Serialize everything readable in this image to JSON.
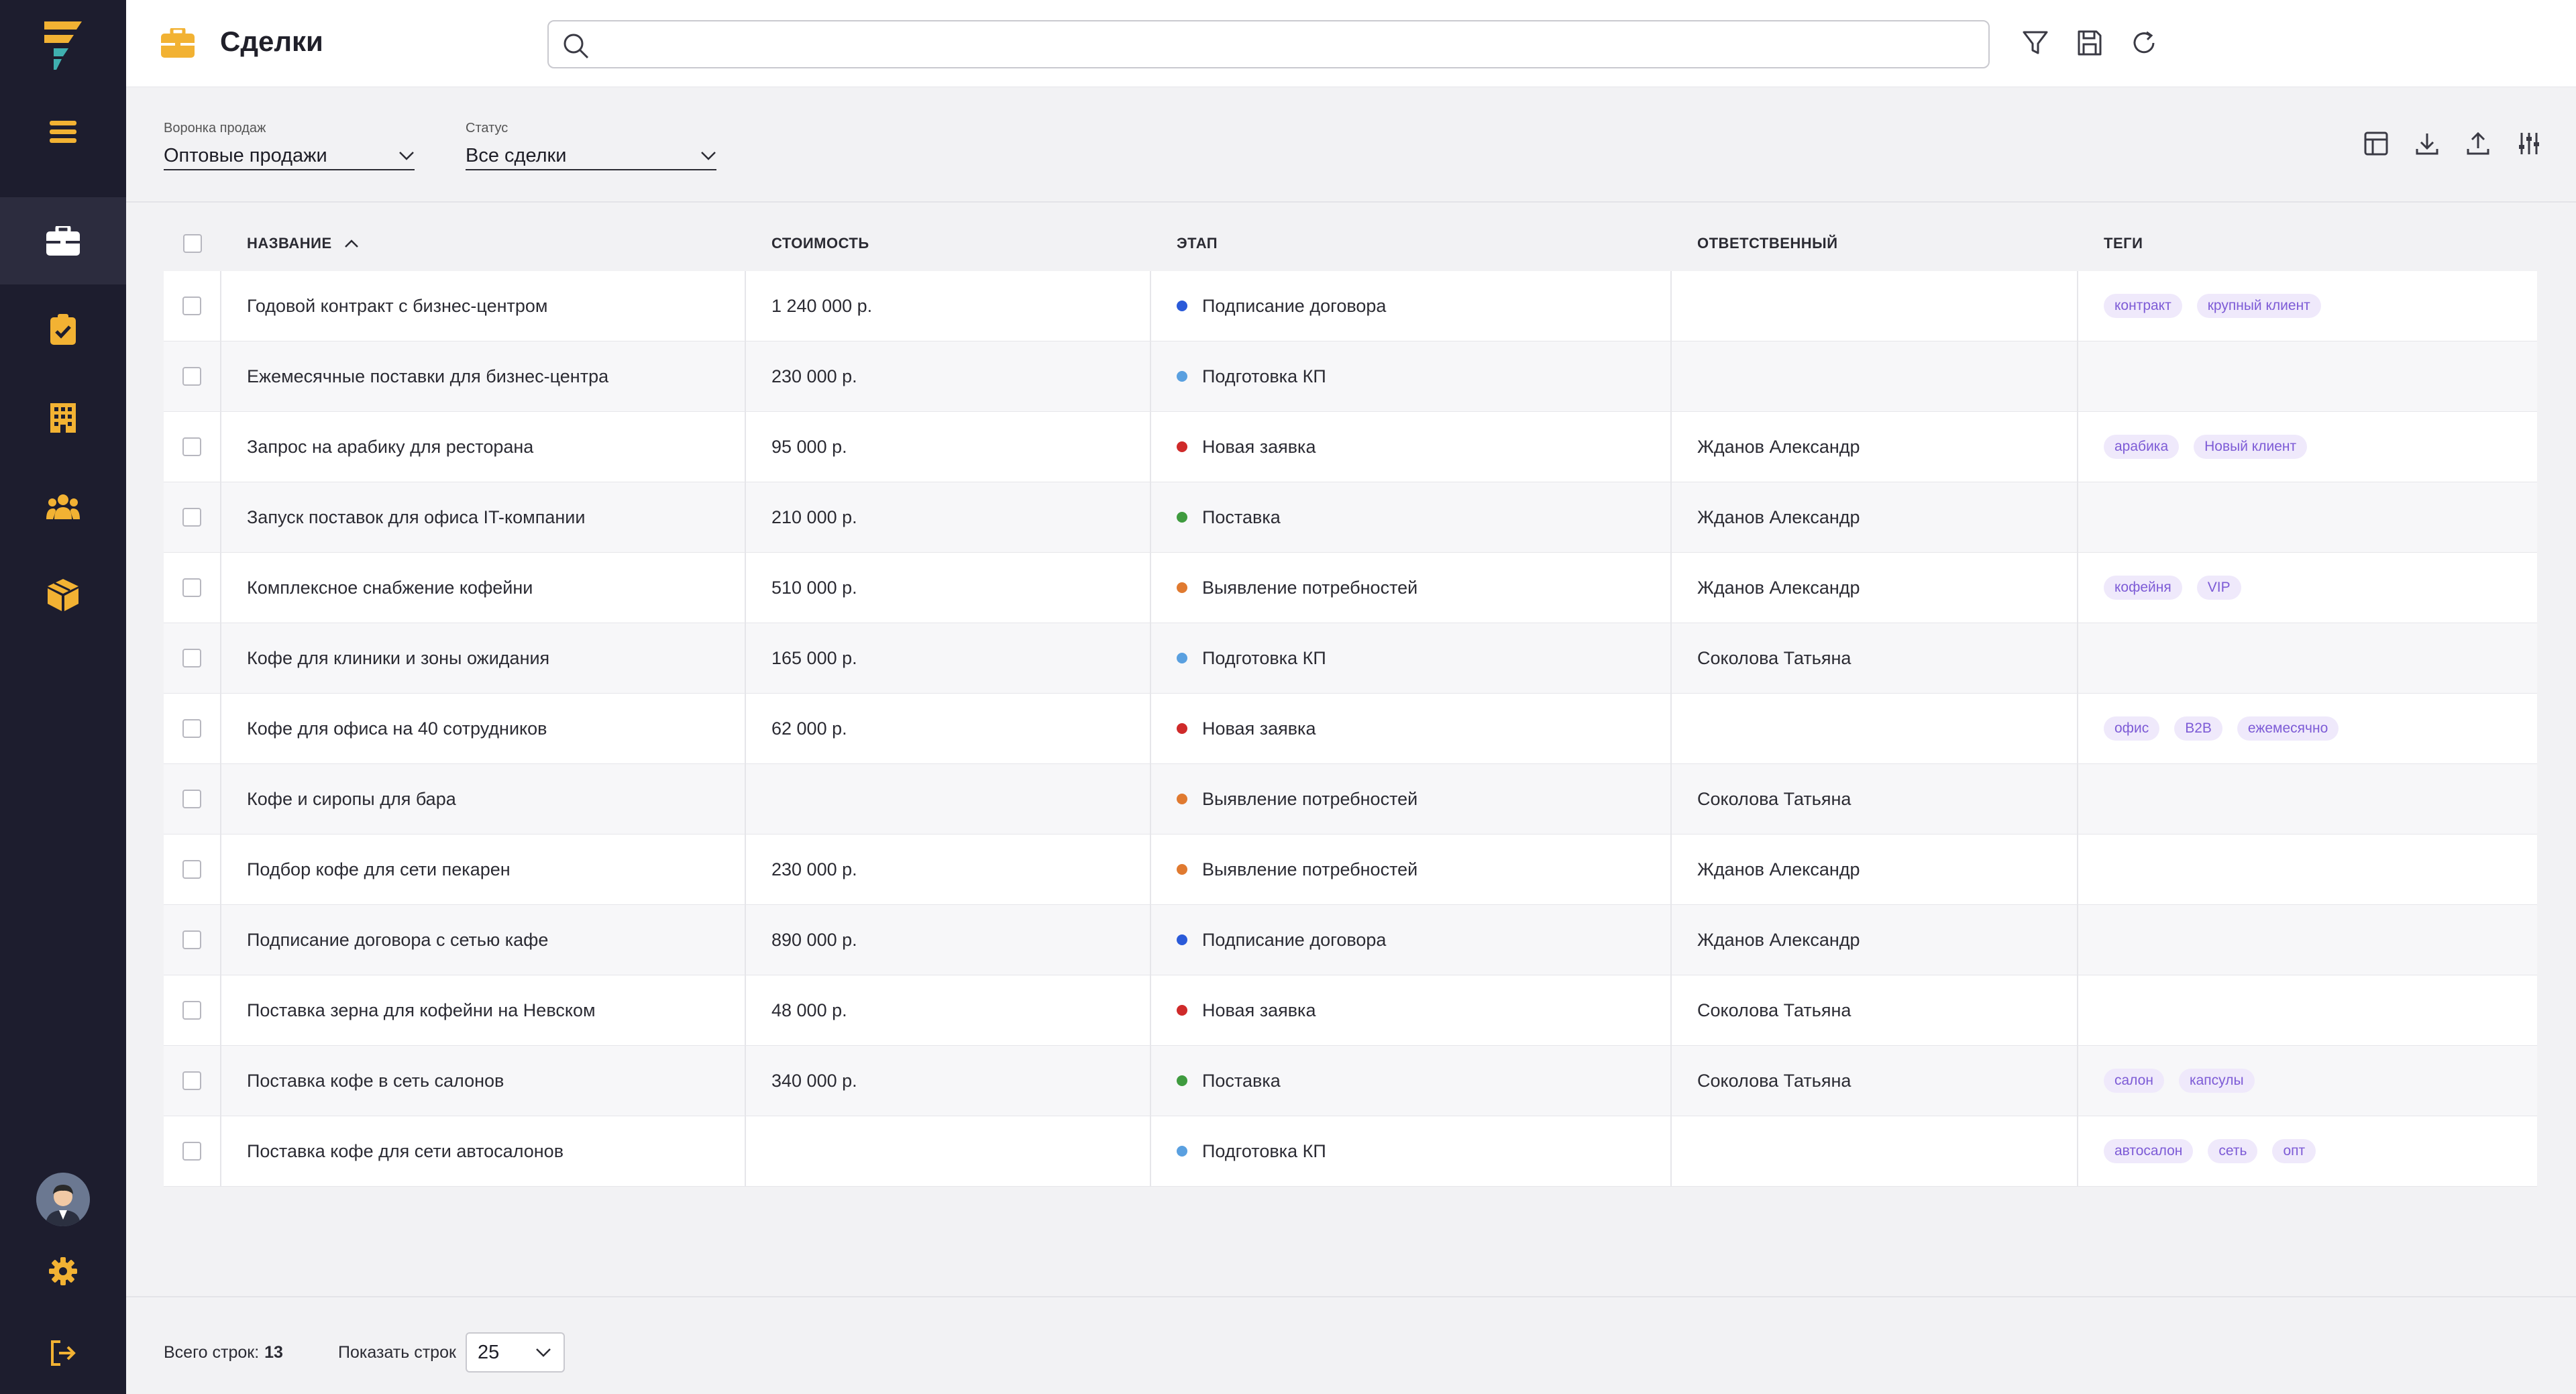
{
  "app": {
    "title": "Сделки"
  },
  "search": {
    "value": "",
    "placeholder": ""
  },
  "filters": {
    "funnel": {
      "label": "Воронка продаж",
      "value": "Оптовые продажи"
    },
    "status": {
      "label": "Статус",
      "value": "Все сделки"
    }
  },
  "table": {
    "columns": {
      "name": "НАЗВАНИЕ",
      "cost": "СТОИМОСТЬ",
      "stage": "ЭТАП",
      "responsible": "ОТВЕТСТВЕННЫЙ",
      "tags": "ТЕГИ"
    },
    "rows": [
      {
        "name": "Годовой контракт с бизнес-центром",
        "cost": "1 240 000 р.",
        "stage": "Подписание договора",
        "stage_color": "#2a5ad9",
        "responsible": "",
        "tags": [
          "контракт",
          "крупный клиент"
        ]
      },
      {
        "name": "Ежемесячные поставки для бизнес-центра",
        "cost": "230 000 р.",
        "stage": "Подготовка КП",
        "stage_color": "#5aa0e0",
        "responsible": "",
        "tags": []
      },
      {
        "name": "Запрос на арабику для ресторана",
        "cost": "95 000 р.",
        "stage": "Новая заявка",
        "stage_color": "#cf2a2a",
        "responsible": "Жданов Александр",
        "tags": [
          "арабика",
          "Новый клиент"
        ]
      },
      {
        "name": "Запуск поставок для офиса IT-компании",
        "cost": "210 000 р.",
        "stage": "Поставка",
        "stage_color": "#3f9b3f",
        "responsible": "Жданов Александр",
        "tags": []
      },
      {
        "name": "Комплексное снабжение кофейни",
        "cost": "510 000 р.",
        "stage": "Выявление потребностей",
        "stage_color": "#e07a30",
        "responsible": "Жданов Александр",
        "tags": [
          "кофейня",
          "VIP"
        ]
      },
      {
        "name": "Кофе для клиники и зоны ожидания",
        "cost": "165 000 р.",
        "stage": "Подготовка КП",
        "stage_color": "#5aa0e0",
        "responsible": "Соколова Татьяна",
        "tags": []
      },
      {
        "name": "Кофе для офиса на 40 сотрудников",
        "cost": "62 000 р.",
        "stage": "Новая заявка",
        "stage_color": "#cf2a2a",
        "responsible": "",
        "tags": [
          "офис",
          "B2B",
          "ежемесячно"
        ]
      },
      {
        "name": "Кофе и сиропы для бара",
        "cost": "",
        "stage": "Выявление потребностей",
        "stage_color": "#e07a30",
        "responsible": "Соколова Татьяна",
        "tags": []
      },
      {
        "name": "Подбор кофе для сети пекарен",
        "cost": "230 000 р.",
        "stage": "Выявление потребностей",
        "stage_color": "#e07a30",
        "responsible": "Жданов Александр",
        "tags": []
      },
      {
        "name": "Подписание договора с сетью кафе",
        "cost": "890 000 р.",
        "stage": "Подписание договора",
        "stage_color": "#2a5ad9",
        "responsible": "Жданов Александр",
        "tags": []
      },
      {
        "name": "Поставка зерна для кофейни на Невском",
        "cost": "48 000 р.",
        "stage": "Новая заявка",
        "stage_color": "#cf2a2a",
        "responsible": "Соколова Татьяна",
        "tags": []
      },
      {
        "name": "Поставка кофе в сеть салонов",
        "cost": "340 000 р.",
        "stage": "Поставка",
        "stage_color": "#3f9b3f",
        "responsible": "Соколова Татьяна",
        "tags": [
          "салон",
          "капсулы"
        ]
      },
      {
        "name": "Поставка кофе для сети автосалонов",
        "cost": "",
        "stage": "Подготовка КП",
        "stage_color": "#5aa0e0",
        "responsible": "",
        "tags": [
          "автосалон",
          "сеть",
          "опт"
        ]
      }
    ]
  },
  "footer": {
    "total_label": "Всего строк:",
    "total_value": "13",
    "show_label": "Показать строк",
    "page_size": "25"
  },
  "colors": {
    "sidebar_bg": "#1d1d2e",
    "accent": "#f2b233",
    "tag_bg": "#efe9fb",
    "tag_text": "#7d5bd6"
  },
  "icons": {
    "sidebar": [
      "logo-icon",
      "menu-icon",
      "briefcase-icon",
      "clipboard-check-icon",
      "building-icon",
      "users-icon",
      "box-icon",
      "settings-icon",
      "logout-icon"
    ],
    "header": [
      "search-icon",
      "filter-icon",
      "save-icon",
      "refresh-icon"
    ],
    "toolbar": [
      "layout-icon",
      "download-icon",
      "upload-icon",
      "sliders-icon"
    ]
  }
}
